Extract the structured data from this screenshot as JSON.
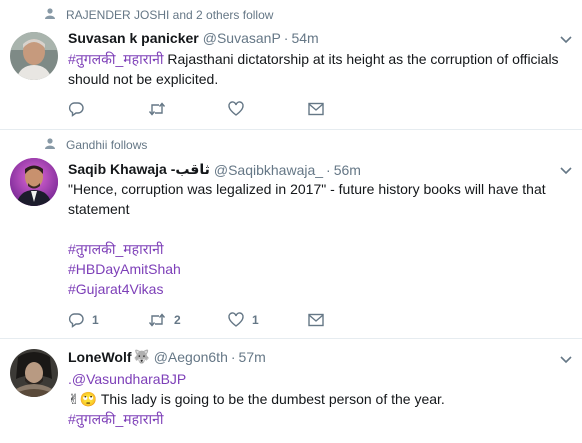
{
  "tweets": [
    {
      "context": "RAJENDER JOSHI and 2 others follow",
      "name": "Suvasan k panicker",
      "handle": "@SuvasanP",
      "dot": "·",
      "time": "54m",
      "hashtag": "#तुगलकी_महारानी",
      "text": "Rajasthani dictatorship at its height as the corruption of officials should not be explicited.",
      "counts": {
        "reply": "",
        "retweet": "",
        "like": ""
      }
    },
    {
      "context": "Gandhii follows",
      "name": "Saqib Khawaja -ثاقب",
      "handle": "@Saqibkhawaja_",
      "dot": "·",
      "time": "56m",
      "text": "\"Hence, corruption was legalized in 2017\" - future history books will have that statement",
      "hashtags": [
        "#तुगलकी_महारानी",
        "#HBDayAmitShah",
        "#Gujarat4Vikas"
      ],
      "counts": {
        "reply": "1",
        "retweet": "2",
        "like": "1"
      }
    },
    {
      "name": "LoneWolf",
      "name_badge": "🐺",
      "handle": "@Aegon6th",
      "dot": "·",
      "time": "57m",
      "mention": ".@VasundharaBJP",
      "emoji": "✌🙄",
      "text": "This lady is going to be the dumbest person of the year.",
      "hashtag": "#तुगलकी_महारानी"
    }
  ],
  "icons": [
    "person-icon",
    "caret-down-icon",
    "reply-icon",
    "retweet-icon",
    "like-icon",
    "message-icon"
  ],
  "colors": {
    "hashtag": "#7d3fb8",
    "secondary_text": "#657786",
    "divider": "#e6ecf0"
  }
}
